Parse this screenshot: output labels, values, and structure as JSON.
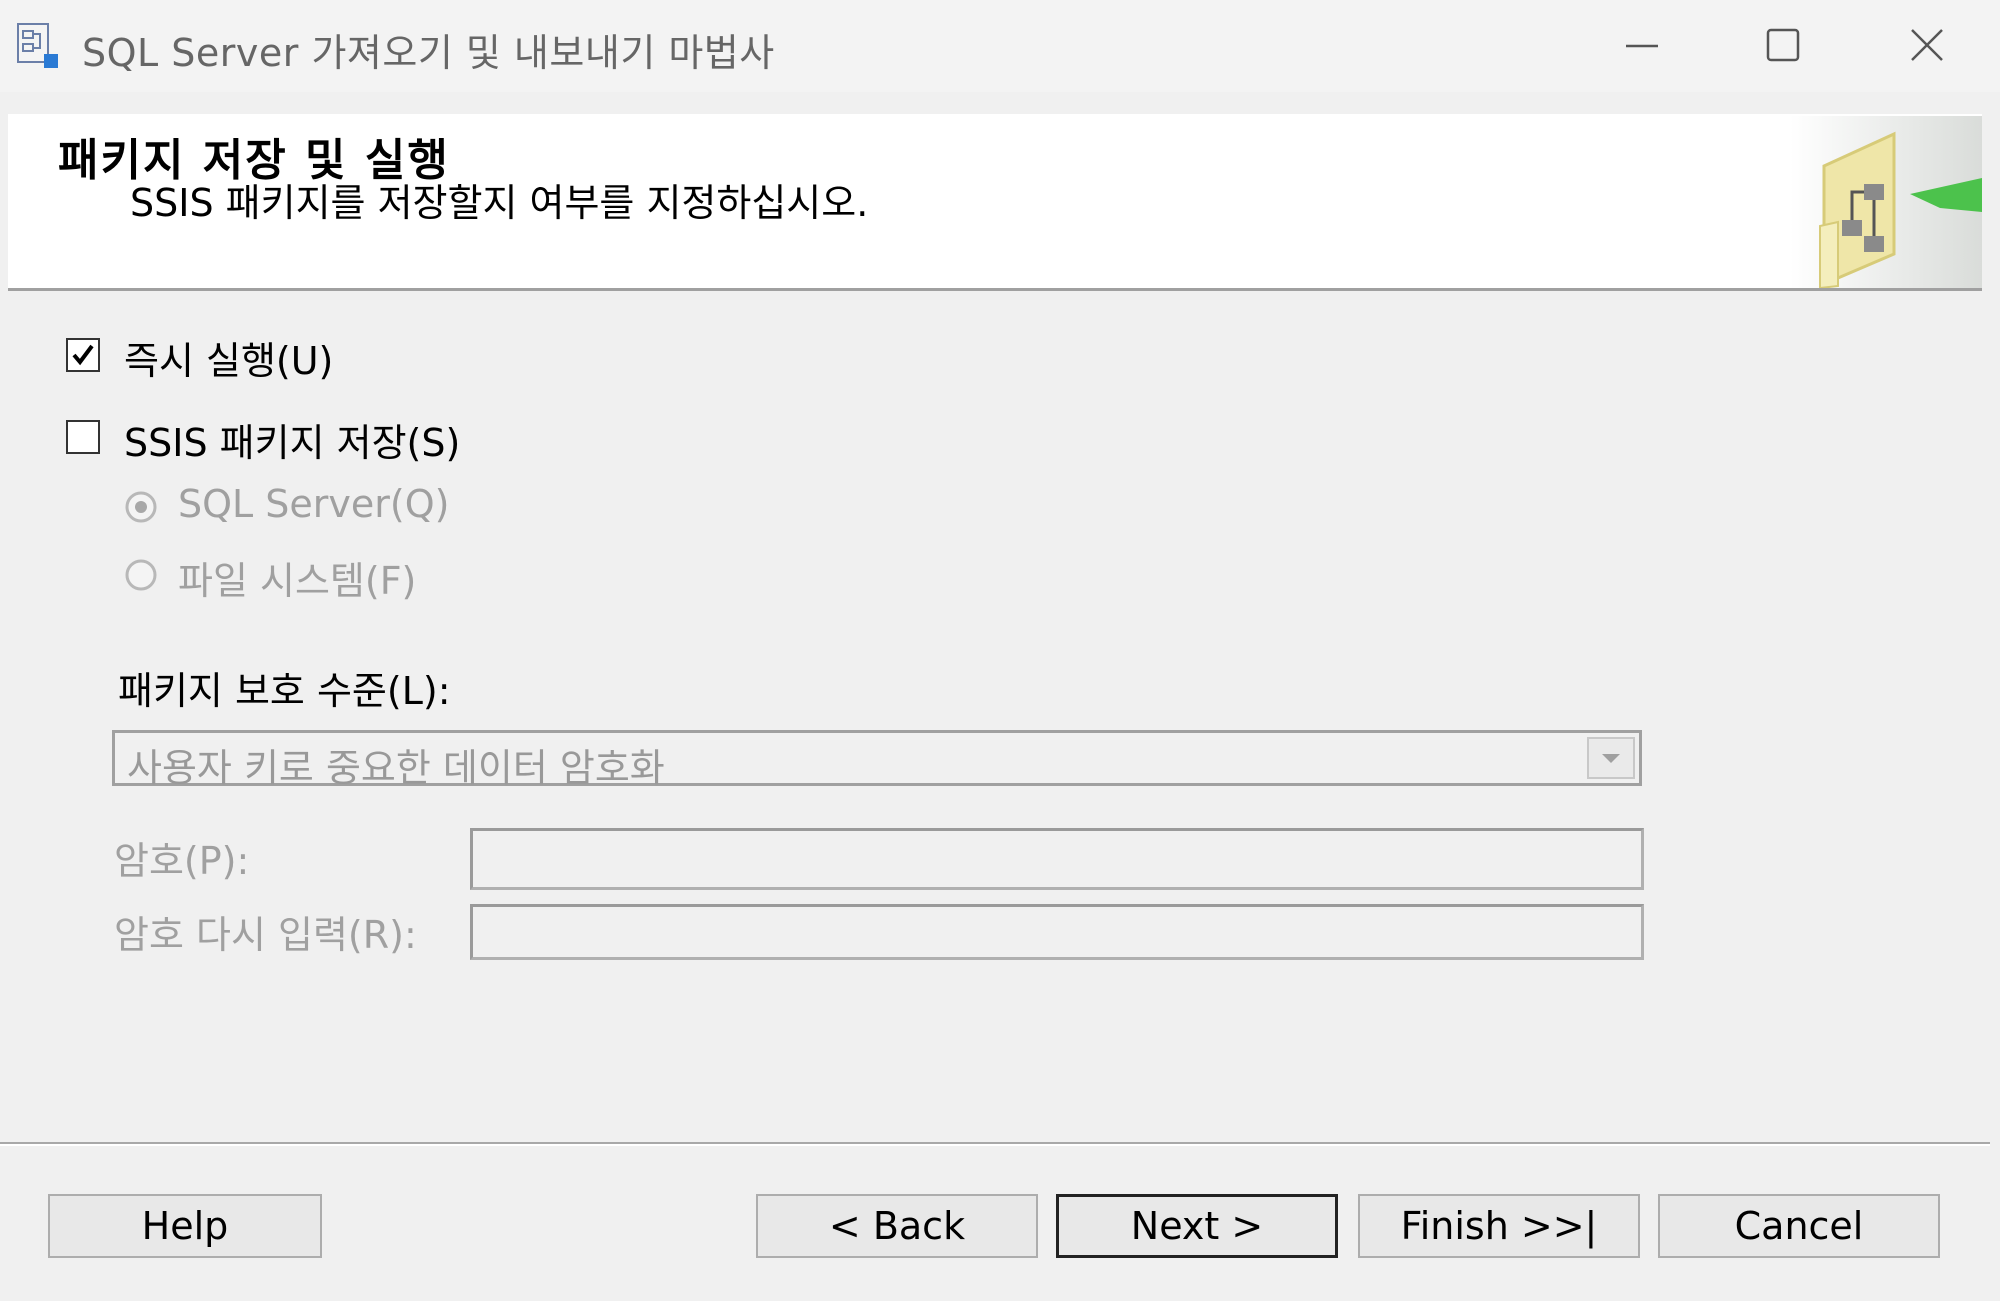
{
  "window": {
    "title": "SQL Server 가져오기 및 내보내기 마법사",
    "app_icon": "wizard-icon",
    "controls": [
      "minimize-icon",
      "maximize-icon",
      "close-icon"
    ]
  },
  "header": {
    "title": "패키지 저장 및 실행",
    "subtitle": "SSIS 패키지를 저장할지 여부를 지정하십시오."
  },
  "options": {
    "run_immediately": {
      "label": "즉시 실행(U)",
      "checked": true
    },
    "save_package": {
      "label": "SSIS 패키지 저장(S)",
      "checked": false
    },
    "save_targets": [
      {
        "label": "SQL Server(Q)",
        "selected": true,
        "enabled": false
      },
      {
        "label": "파일 시스템(F)",
        "selected": false,
        "enabled": false
      }
    ]
  },
  "protection": {
    "label": "패키지 보호 수준(L):",
    "value": "사용자 키로 중요한 데이터 암호화"
  },
  "password": {
    "label": "암호(P):",
    "value": ""
  },
  "password_confirm": {
    "label": "암호 다시 입력(R):",
    "value": ""
  },
  "buttons": {
    "help": "Help",
    "back": "< Back",
    "next": "Next >",
    "finish": "Finish >>|",
    "cancel": "Cancel"
  },
  "colors": {
    "window_bg": "#f0f0f0",
    "header_bg": "#ffffff",
    "disabled_text": "#a0a0a0"
  }
}
